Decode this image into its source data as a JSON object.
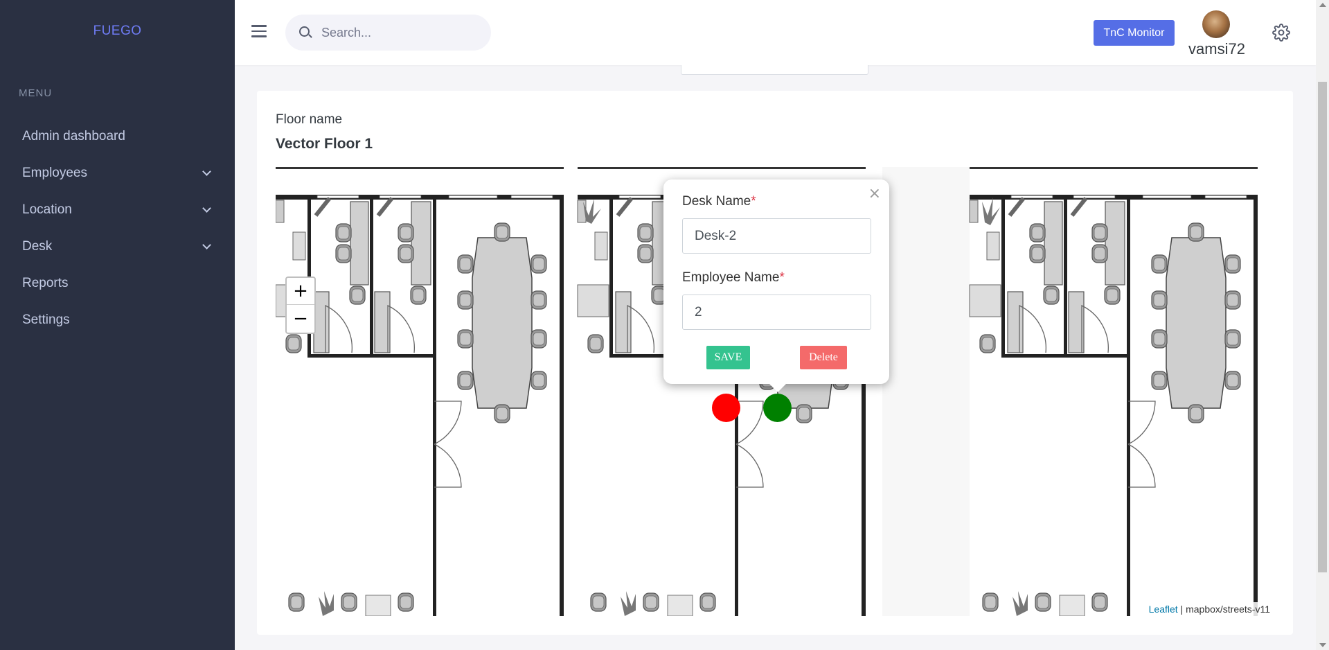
{
  "sidebar": {
    "brand": "FUEGO",
    "menu_title": "MENU",
    "items": [
      {
        "label": "Admin dashboard",
        "has_submenu": false
      },
      {
        "label": "Employees",
        "has_submenu": true
      },
      {
        "label": "Location",
        "has_submenu": true
      },
      {
        "label": "Desk",
        "has_submenu": true
      },
      {
        "label": "Reports",
        "has_submenu": false
      },
      {
        "label": "Settings",
        "has_submenu": false
      }
    ]
  },
  "header": {
    "search_placeholder": "Search...",
    "monitor_button": "TnC Monitor",
    "username": "vamsi72",
    "icons": [
      "hamburger-icon",
      "search-icon",
      "avatar",
      "gear-icon"
    ]
  },
  "floor": {
    "label": "Floor name",
    "value": "Vector Floor 1"
  },
  "map": {
    "zoom_in": "+",
    "zoom_out": "−",
    "attribution_link": "Leaflet",
    "attribution_separator": " | ",
    "attribution_text": "mapbox/streets-v11",
    "markers": [
      {
        "status": "occupied",
        "color": "#ff0000"
      },
      {
        "status": "available",
        "color": "#008000"
      }
    ]
  },
  "popup": {
    "close": "×",
    "desk_label": "Desk Name",
    "desk_value": "Desk-2",
    "employee_label": "Employee Name",
    "employee_value": "2",
    "required_mark": "*",
    "save_label": "SAVE",
    "delete_label": "Delete"
  },
  "colors": {
    "sidebar_bg": "#2a3042",
    "brand": "#6f7cf5",
    "primary": "#556ee6",
    "save": "#34c38f",
    "delete": "#f46a6a"
  }
}
